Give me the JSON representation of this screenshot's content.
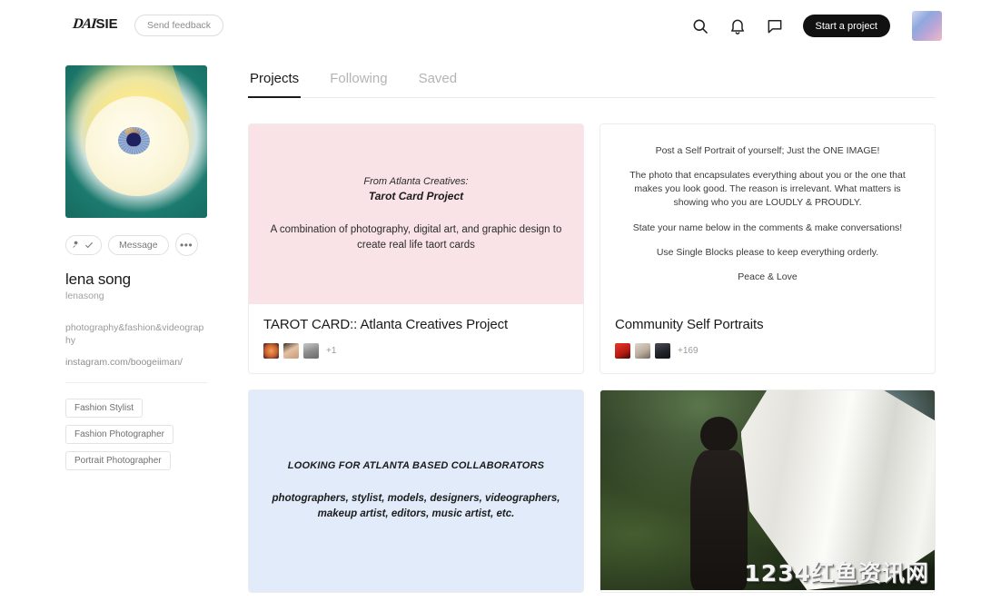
{
  "header": {
    "logo_script": "DAI",
    "logo_bold": "SIE",
    "feedback_label": "Send feedback",
    "search_icon": "search-icon",
    "notifications_icon": "bell-icon",
    "messages_icon": "chat-icon",
    "start_project_label": "Start a project",
    "user_avatar": "user-avatar"
  },
  "profile": {
    "photo_alt": "eyeball-artwork",
    "follow_label": "",
    "message_label": "Message",
    "more_label": "•••",
    "name": "lena song",
    "handle": "lenasong",
    "bio": "photography&fashion&videography",
    "link": "instagram.com/boogeiiman/",
    "tags": [
      {
        "label": "Fashion Stylist"
      },
      {
        "label": "Fashion Photographer"
      },
      {
        "label": "Portrait Photographer"
      }
    ]
  },
  "main": {
    "tabs": [
      {
        "label": "Projects",
        "active": true
      },
      {
        "label": "Following",
        "active": false
      },
      {
        "label": "Saved",
        "active": false
      }
    ],
    "cards": [
      {
        "media_type": "pink-text",
        "media_bg": "#f9e3e6",
        "eyebrow": "From Atlanta Creatives:",
        "headline": "Tarot Card Project",
        "body": "A combination of photography, digital art, and graphic design to create real life taort cards",
        "title": "TAROT CARD:: Atlanta Creatives Project",
        "extra_count": "+1",
        "avatar_colors": [
          "#d4713f",
          "#d9b49a",
          "#8a8a8a"
        ]
      },
      {
        "media_type": "white-text",
        "media_bg": "#ffffff",
        "lines": [
          "Post a Self Portrait of yourself; Just the ONE IMAGE!",
          "The photo that encapsulates everything about you or the one that makes you look good. The reason is irrelevant. What matters is showing who you are LOUDLY & PROUDLY.",
          "State your name below in the comments & make conversations!",
          "Use Single Blocks please to keep everything orderly.",
          "Peace & Love"
        ],
        "title": "Community Self Portraits",
        "extra_count": "+169",
        "avatar_colors": [
          "#d02b22",
          "#cfc6b8",
          "#2b2b33"
        ]
      },
      {
        "media_type": "blue-text",
        "media_bg": "#e1ebfa",
        "headline": "LOOKING FOR ATLANTA BASED COLLABORATORS",
        "body": "photographers, stylist, models, designers, videographers, makeup artist, editors, music artist, etc."
      },
      {
        "media_type": "photo",
        "photo_alt": "person-with-white-fabric-in-forest",
        "watermark": "1234红鱼资讯网"
      }
    ]
  }
}
